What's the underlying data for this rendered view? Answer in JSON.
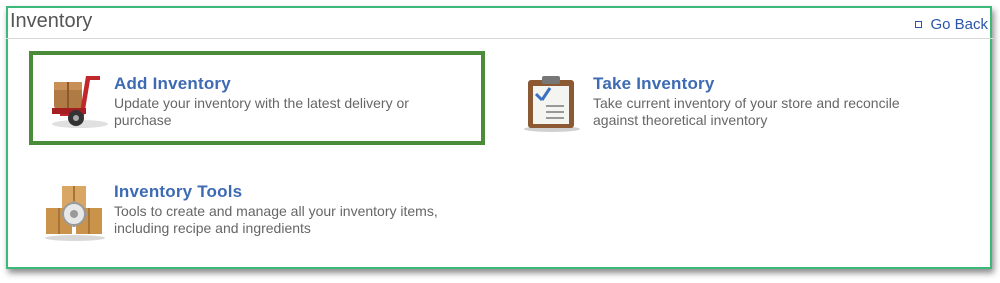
{
  "header": {
    "title": "Inventory",
    "go_back": "Go Back"
  },
  "tiles": [
    {
      "title": "Add Inventory",
      "desc_line1": "Update your inventory with the latest delivery or",
      "desc_line2": "purchase",
      "icon": "hand-truck-icon"
    },
    {
      "title": "Take Inventory",
      "desc_line1": "Take current inventory of your store and reconcile",
      "desc_line2": "against theoretical inventory",
      "icon": "clipboard-icon"
    },
    {
      "title": "Inventory Tools",
      "desc_line1": "Tools to create and manage all your inventory items,",
      "desc_line2": "including recipe and ingredients",
      "icon": "boxes-gear-icon"
    }
  ],
  "colors": {
    "frame_border": "#3cb878",
    "highlight_border": "#4a8c3a",
    "link": "#3d6bb3"
  }
}
